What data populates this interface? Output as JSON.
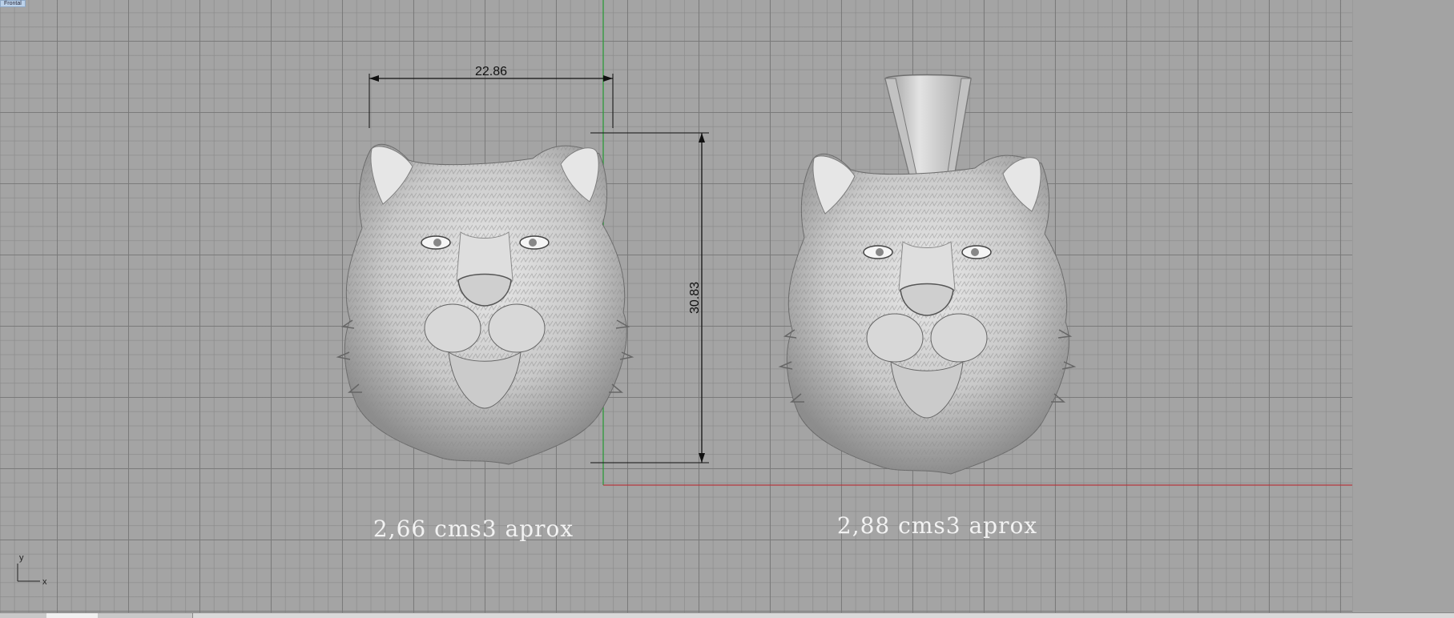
{
  "viewport": {
    "label": "Frontal"
  },
  "dimensions": {
    "width_value": "22.86",
    "height_value": "30.83"
  },
  "captions": {
    "left": "2,66 cms3 aprox",
    "right": "2,88 cms3 aprox"
  },
  "axis_indicator": {
    "y_label": "y",
    "x_label": "x"
  },
  "colors": {
    "grid_bg": "#a4a4a4",
    "x_axis": "#b4383e",
    "y_axis": "#2d9a3a",
    "dimension_line": "#111111",
    "caption": "#f2f2f2",
    "model_surface": "#d6d6d6"
  },
  "models": [
    {
      "name": "tiger-head-model",
      "has_bail": false
    },
    {
      "name": "tiger-pendant-model",
      "has_bail": true
    }
  ],
  "tabs": [
    {
      "label": "",
      "active": false
    },
    {
      "label": "",
      "active": true
    },
    {
      "label": "",
      "active": false
    },
    {
      "label": "",
      "active": false
    }
  ]
}
